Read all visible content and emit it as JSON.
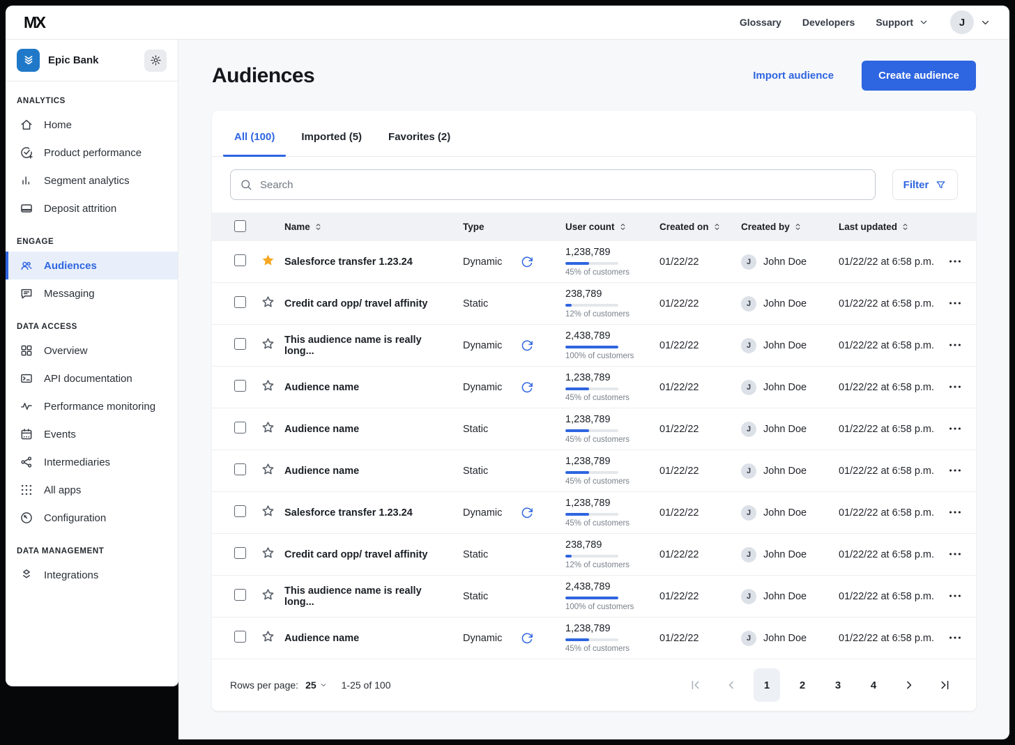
{
  "colors": {
    "accent": "#2E65E0",
    "star": "#F6A723",
    "org_logo_bg": "#2079C8",
    "page_bg": "#F7F8FA",
    "header_row_bg": "#F0F2F5"
  },
  "icons": {
    "search": "search-icon",
    "filter": "filter-icon",
    "chevron_down": "chevron-down-icon",
    "sort": "sort-icon",
    "gear": "gear-icon",
    "refresh": "refresh-icon",
    "star_filled": "star-filled-icon",
    "star_outline": "star-outline-icon",
    "kebab": "kebab-icon",
    "org_logo": "epic-bank-logo-icon",
    "first_page": "first-page-icon",
    "prev_page": "prev-page-icon",
    "next_page": "next-page-icon",
    "last_page": "last-page-icon"
  },
  "topbar": {
    "logo": "MX",
    "glossary": "Glossary",
    "developers": "Developers",
    "support": "Support",
    "avatar_initial": "J"
  },
  "sidebar": {
    "org_name": "Epic Bank",
    "sections": {
      "analytics": {
        "title": "ANALYTICS",
        "items": [
          {
            "name": "sidebar-item-home",
            "label": "Home",
            "icon": "home-icon",
            "active": false
          },
          {
            "name": "sidebar-item-product-performance",
            "label": "Product performance",
            "icon": "product-performance-icon",
            "active": false
          },
          {
            "name": "sidebar-item-segment-analytics",
            "label": "Segment analytics",
            "icon": "segment-analytics-icon",
            "active": false
          },
          {
            "name": "sidebar-item-deposit-attrition",
            "label": "Deposit attrition",
            "icon": "deposit-attrition-icon",
            "active": false
          }
        ]
      },
      "engage": {
        "title": "ENGAGE",
        "items": [
          {
            "name": "sidebar-item-audiences",
            "label": "Audiences",
            "icon": "audiences-icon",
            "active": true
          },
          {
            "name": "sidebar-item-messaging",
            "label": "Messaging",
            "icon": "messaging-icon",
            "active": false
          }
        ]
      },
      "data_access": {
        "title": "DATA ACCESS",
        "items": [
          {
            "name": "sidebar-item-overview",
            "label": "Overview",
            "icon": "overview-icon",
            "active": false
          },
          {
            "name": "sidebar-item-api-documentation",
            "label": "API documentation",
            "icon": "api-documentation-icon",
            "active": false
          },
          {
            "name": "sidebar-item-performance-monitoring",
            "label": "Performance monitoring",
            "icon": "performance-monitoring-icon",
            "active": false
          },
          {
            "name": "sidebar-item-events",
            "label": "Events",
            "icon": "events-icon",
            "active": false
          },
          {
            "name": "sidebar-item-intermediaries",
            "label": "Intermediaries",
            "icon": "intermediaries-icon",
            "active": false
          },
          {
            "name": "sidebar-item-all-apps",
            "label": "All apps",
            "icon": "all-apps-icon",
            "active": false
          },
          {
            "name": "sidebar-item-configuration",
            "label": "Configuration",
            "icon": "configuration-icon",
            "active": false
          }
        ]
      },
      "data_management": {
        "title": "DATA MANAGEMENT",
        "items": [
          {
            "name": "sidebar-item-integrations",
            "label": "Integrations",
            "icon": "integrations-icon",
            "active": false
          }
        ]
      }
    }
  },
  "page": {
    "title": "Audiences",
    "import_label": "Import audience",
    "create_label": "Create audience"
  },
  "tabs": [
    {
      "name": "tab-all",
      "label": "All (100)",
      "active": true
    },
    {
      "name": "tab-imported",
      "label": "Imported (5)",
      "active": false
    },
    {
      "name": "tab-favorites",
      "label": "Favorites (2)",
      "active": false
    }
  ],
  "toolbar": {
    "search_placeholder": "Search",
    "filter_label": "Filter"
  },
  "table": {
    "headers": {
      "name": "Name",
      "type": "Type",
      "user_count": "User count",
      "created_on": "Created on",
      "created_by": "Created by",
      "last_updated": "Last updated"
    },
    "rows": [
      {
        "favorite": true,
        "name": "Salesforce transfer 1.23.24",
        "type": "Dynamic",
        "refresh": true,
        "user_count": "1,238,789",
        "percent": 45,
        "percent_label": "45% of customers",
        "created_on": "01/22/22",
        "avatar_initial": "J",
        "created_by": "John Doe",
        "last_updated": "01/22/22 at 6:58 p.m."
      },
      {
        "favorite": false,
        "name": "Credit card opp/ travel affinity",
        "type": "Static",
        "refresh": false,
        "user_count": "238,789",
        "percent": 12,
        "percent_label": "12% of customers",
        "created_on": "01/22/22",
        "avatar_initial": "J",
        "created_by": "John Doe",
        "last_updated": "01/22/22 at 6:58 p.m."
      },
      {
        "favorite": false,
        "name": "This audience name is really long...",
        "type": "Dynamic",
        "refresh": true,
        "user_count": "2,438,789",
        "percent": 100,
        "percent_label": "100% of customers",
        "created_on": "01/22/22",
        "avatar_initial": "J",
        "created_by": "John Doe",
        "last_updated": "01/22/22 at 6:58 p.m."
      },
      {
        "favorite": false,
        "name": "Audience name",
        "type": "Dynamic",
        "refresh": true,
        "user_count": "1,238,789",
        "percent": 45,
        "percent_label": "45% of customers",
        "created_on": "01/22/22",
        "avatar_initial": "J",
        "created_by": "John Doe",
        "last_updated": "01/22/22 at 6:58 p.m."
      },
      {
        "favorite": false,
        "name": "Audience name",
        "type": "Static",
        "refresh": false,
        "user_count": "1,238,789",
        "percent": 45,
        "percent_label": "45% of customers",
        "created_on": "01/22/22",
        "avatar_initial": "J",
        "created_by": "John Doe",
        "last_updated": "01/22/22 at 6:58 p.m."
      },
      {
        "favorite": false,
        "name": "Audience name",
        "type": "Static",
        "refresh": false,
        "user_count": "1,238,789",
        "percent": 45,
        "percent_label": "45% of customers",
        "created_on": "01/22/22",
        "avatar_initial": "J",
        "created_by": "John Doe",
        "last_updated": "01/22/22 at 6:58 p.m."
      },
      {
        "favorite": false,
        "name": "Salesforce transfer 1.23.24",
        "type": "Dynamic",
        "refresh": true,
        "user_count": "1,238,789",
        "percent": 45,
        "percent_label": "45% of customers",
        "created_on": "01/22/22",
        "avatar_initial": "J",
        "created_by": "John Doe",
        "last_updated": "01/22/22 at 6:58 p.m."
      },
      {
        "favorite": false,
        "name": "Credit card opp/ travel affinity",
        "type": "Static",
        "refresh": false,
        "user_count": "238,789",
        "percent": 12,
        "percent_label": "12% of customers",
        "created_on": "01/22/22",
        "avatar_initial": "J",
        "created_by": "John Doe",
        "last_updated": "01/22/22 at 6:58 p.m."
      },
      {
        "favorite": false,
        "name": "This audience name is really long...",
        "type": "Static",
        "refresh": false,
        "user_count": "2,438,789",
        "percent": 100,
        "percent_label": "100% of customers",
        "created_on": "01/22/22",
        "avatar_initial": "J",
        "created_by": "John Doe",
        "last_updated": "01/22/22 at 6:58 p.m."
      },
      {
        "favorite": false,
        "name": "Audience name",
        "type": "Dynamic",
        "refresh": true,
        "user_count": "1,238,789",
        "percent": 45,
        "percent_label": "45% of customers",
        "created_on": "01/22/22",
        "avatar_initial": "J",
        "created_by": "John Doe",
        "last_updated": "01/22/22 at 6:58 p.m."
      }
    ]
  },
  "footer": {
    "rows_per_page_label": "Rows per page:",
    "rows_per_page_value": "25",
    "range_label": "1-25 of 100",
    "pages": [
      {
        "name": "page-1-button",
        "label": "1",
        "active": true
      },
      {
        "name": "page-2-button",
        "label": "2",
        "active": false
      },
      {
        "name": "page-3-button",
        "label": "3",
        "active": false
      },
      {
        "name": "page-4-button",
        "label": "4",
        "active": false
      }
    ]
  }
}
